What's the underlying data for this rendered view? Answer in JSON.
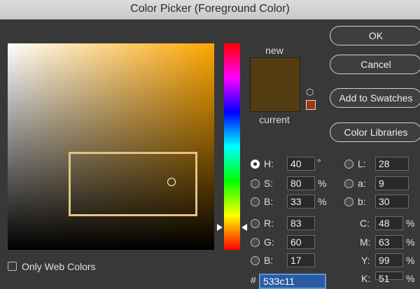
{
  "window": {
    "title": "Color Picker (Foreground Color)"
  },
  "buttons": {
    "ok": "OK",
    "cancel": "Cancel",
    "add_to_swatches": "Add to Swatches",
    "color_libraries": "Color Libraries"
  },
  "preview": {
    "new_label": "new",
    "current_label": "current",
    "new_color": "#533c11",
    "current_color": "#533c11"
  },
  "hsb": {
    "h": {
      "label": "H:",
      "value": "40",
      "unit": "°"
    },
    "s": {
      "label": "S:",
      "value": "80",
      "unit": "%"
    },
    "b": {
      "label": "B:",
      "value": "33",
      "unit": "%"
    }
  },
  "rgb": {
    "r": {
      "label": "R:",
      "value": "83"
    },
    "g": {
      "label": "G:",
      "value": "60"
    },
    "b": {
      "label": "B:",
      "value": "17"
    }
  },
  "lab": {
    "l": {
      "label": "L:",
      "value": "28"
    },
    "a": {
      "label": "a:",
      "value": "9"
    },
    "b": {
      "label": "b:",
      "value": "30"
    }
  },
  "cmyk": {
    "c": {
      "label": "C:",
      "value": "48",
      "unit": "%"
    },
    "m": {
      "label": "M:",
      "value": "63",
      "unit": "%"
    },
    "y": {
      "label": "Y:",
      "value": "99",
      "unit": "%"
    },
    "k": {
      "label": "K:",
      "value": "51",
      "unit": "%"
    }
  },
  "hex": {
    "label": "#",
    "value": "533c11"
  },
  "options": {
    "only_web_colors": "Only Web Colors"
  }
}
